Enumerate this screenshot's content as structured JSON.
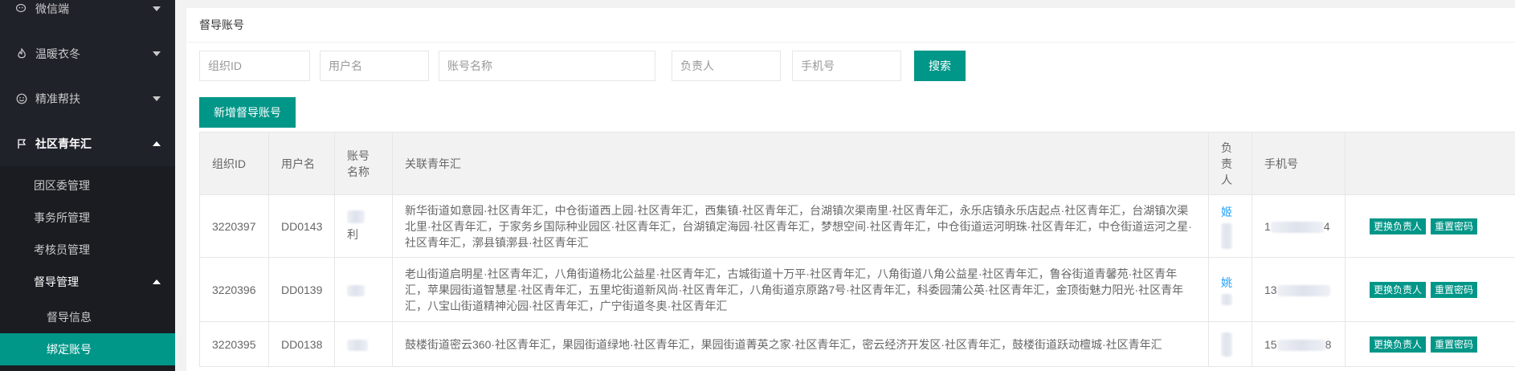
{
  "sidebar": {
    "items": [
      {
        "label": "微信端",
        "icon": "wechat-icon"
      },
      {
        "label": "温暖衣冬",
        "icon": "flame-icon"
      },
      {
        "label": "精准帮扶",
        "icon": "smile-icon"
      },
      {
        "label": "社区青年汇",
        "icon": "flag-icon"
      }
    ],
    "sub_items": [
      {
        "label": "团区委管理"
      },
      {
        "label": "事务所管理"
      },
      {
        "label": "考核员管理"
      },
      {
        "label": "督导管理"
      }
    ],
    "subsub_items": [
      {
        "label": "督导信息"
      },
      {
        "label": "绑定账号"
      }
    ]
  },
  "panel": {
    "title": "督导账号",
    "filters": {
      "org_id": "组织ID",
      "username": "用户名",
      "account_name": "账号名称",
      "manager": "负责人",
      "phone": "手机号"
    },
    "search_label": "搜索",
    "add_label": "新增督导账号"
  },
  "table": {
    "headers": {
      "org_id": "组织ID",
      "username": "用户名",
      "account_name": "账号名称",
      "assoc": "关联青年汇",
      "manager": "负责人",
      "phone": "手机号"
    },
    "rows": [
      {
        "org_id": "3220397",
        "username": "DD0143",
        "account_name": "利",
        "assoc": "新华街道如意园·社区青年汇，中仓街道西上园·社区青年汇，西集镇·社区青年汇，台湖镇次渠南里·社区青年汇，永乐店镇永乐店起点·社区青年汇，台湖镇次渠北里·社区青年汇，于家务乡国际种业园区·社区青年汇，台湖镇定海园·社区青年汇，梦想空间·社区青年汇，中仓街道运河明珠·社区青年汇，中仓街道运河之星·社区青年汇，漷县镇漷县·社区青年汇",
        "manager": "姬",
        "phone_prefix": "1",
        "phone_suffix": "4",
        "btn_change": "更换负责人",
        "btn_reset": "重置密码"
      },
      {
        "org_id": "3220396",
        "username": "DD0139",
        "account_name": "",
        "assoc": "老山街道启明星·社区青年汇，八角街道杨北公益星·社区青年汇，古城街道十万平·社区青年汇，八角街道八角公益星·社区青年汇，鲁谷街道青馨苑·社区青年汇，苹果园街道智慧星·社区青年汇，五里坨街道新风尚·社区青年汇，八角街道京原路7号·社区青年汇，科委园蒲公英·社区青年汇，金顶街魅力阳光·社区青年汇，八宝山街道精神沁园·社区青年汇，广宁街道冬奥·社区青年汇",
        "manager": "姚",
        "phone_prefix": "13",
        "phone_suffix": "",
        "btn_change": "更换负责人",
        "btn_reset": "重置密码"
      },
      {
        "org_id": "3220395",
        "username": "DD0138",
        "account_name": "",
        "assoc": "鼓楼街道密云360·社区青年汇，果园街道绿地·社区青年汇，果园街道菁英之家·社区青年汇，密云经济开发区·社区青年汇，鼓楼街道跃动檀城·社区青年汇",
        "manager": "",
        "phone_prefix": "15",
        "phone_suffix": "8",
        "btn_change": "更换负责人",
        "btn_reset": "重置密码"
      }
    ]
  },
  "colors": {
    "primary": "#009688",
    "sidebar_bg": "#20222a",
    "link": "#1e9fff"
  }
}
